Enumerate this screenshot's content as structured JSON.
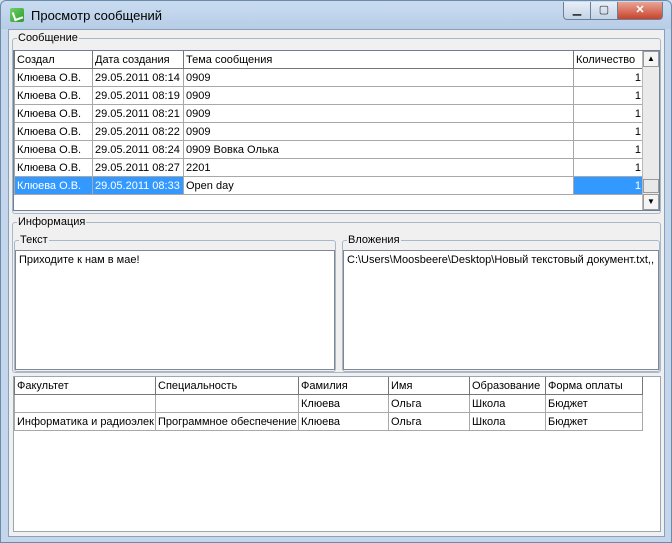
{
  "window": {
    "title": "Просмотр сообщений",
    "min_glyph": "▁",
    "max_glyph": "▢",
    "close_glyph": "✕"
  },
  "messages": {
    "legend": "Сообщение",
    "columns": [
      "Создал",
      "Дата создания",
      "Тема сообщения",
      "Количество"
    ],
    "rows": [
      [
        "Клюева О.В.",
        "29.05.2011 08:14",
        "0909",
        "1"
      ],
      [
        "Клюева О.В.",
        "29.05.2011 08:19",
        "0909",
        "1"
      ],
      [
        "Клюева О.В.",
        "29.05.2011 08:21",
        "0909",
        "1"
      ],
      [
        "Клюева О.В.",
        "29.05.2011 08:22",
        "0909",
        "1"
      ],
      [
        "Клюева О.В.",
        "29.05.2011 08:24",
        "0909 Вовка Олька",
        "1"
      ],
      [
        "Клюева О.В.",
        "29.05.2011 08:27",
        "2201",
        "1"
      ],
      [
        "Клюева О.В.",
        "29.05.2011 08:33",
        "Open day",
        "1"
      ]
    ],
    "selected_row": 6,
    "scroll_up": "▲",
    "scroll_down": "▼"
  },
  "info": {
    "legend": "Информация",
    "text_legend": "Текст",
    "text_value": "Приходите к нам в мае!",
    "attach_legend": "Вложения",
    "attach_value": "C:\\Users\\Moosbeere\\Desktop\\Новый текстовый документ.txt,,"
  },
  "students": {
    "columns": [
      "Факультет",
      "Специальность",
      "Фамилия",
      "Имя",
      "Образование",
      "Форма оплаты"
    ],
    "rows": [
      [
        "",
        "",
        "Клюева",
        "Ольга",
        "Школа",
        "Бюджет"
      ],
      [
        "Информатика и радиоэлек",
        "Программное обеспечение",
        "Клюева",
        "Ольга",
        "Школа",
        "Бюджет"
      ]
    ]
  },
  "colors": {
    "selection": "#3399ff",
    "window_frame": "#c9dcf1"
  }
}
